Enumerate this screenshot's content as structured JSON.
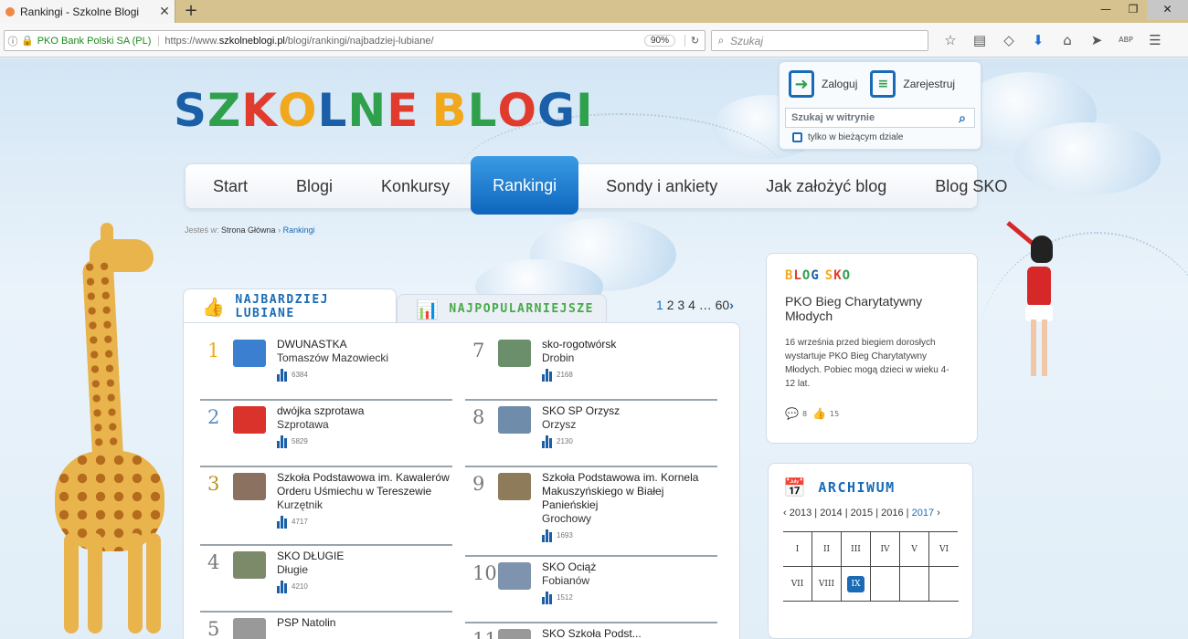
{
  "browser": {
    "tab_title": "Rankingi - Szkolne Blogi",
    "tab_close": "✕",
    "new_tab": "+",
    "url_info": "ⓘ",
    "url_lock": "🔒",
    "cert_label": "PKO Bank Polski SA (PL)",
    "url_prefix": "https://www.",
    "url_domain": "szkolneblogi.pl",
    "url_path": "/blogi/rankingi/najbadziej-lubiane/",
    "zoom": "90%",
    "reload": "↻",
    "search_placeholder": "Szukaj",
    "search_icon": "⌕",
    "win_min": "—",
    "win_max": "❐",
    "win_close": "✕",
    "toolbar": {
      "bookmark_star": "☆",
      "reader_list": "▤",
      "pocket": "◇",
      "download": "⬇",
      "home": "⌂",
      "send": "➤",
      "adblock": "ABP",
      "menu": "☰"
    }
  },
  "header": {
    "logo_letters": [
      {
        "ch": "S",
        "color": "#1a5fa8"
      },
      {
        "ch": "Z",
        "color": "#2fa04b"
      },
      {
        "ch": "K",
        "color": "#e13b2e"
      },
      {
        "ch": "O",
        "color": "#f2a81d"
      },
      {
        "ch": "L",
        "color": "#1a5fa8"
      },
      {
        "ch": "N",
        "color": "#2fa04b"
      },
      {
        "ch": "E",
        "color": "#e13b2e"
      },
      {
        "ch": " ",
        "color": "#000"
      },
      {
        "ch": "B",
        "color": "#f2a81d"
      },
      {
        "ch": "L",
        "color": "#2fa04b"
      },
      {
        "ch": "O",
        "color": "#e13b2e"
      },
      {
        "ch": "G",
        "color": "#1a5fa8"
      },
      {
        "ch": "I",
        "color": "#2fa04b"
      }
    ],
    "login_label": "Zaloguj",
    "login_icon": "➜",
    "register_label": "Zarejestruj",
    "register_icon": "≡",
    "site_search_placeholder": "Szukaj w witrynie",
    "site_search_icon": "⌕",
    "only_section_label": "tylko w bieżącym dziale"
  },
  "menu": [
    {
      "label": "Start",
      "active": false
    },
    {
      "label": "Blogi",
      "active": false
    },
    {
      "label": "Konkursy",
      "active": false
    },
    {
      "label": "Rankingi",
      "active": true
    },
    {
      "label": "Sondy i ankiety",
      "active": false
    },
    {
      "label": "Jak założyć blog",
      "active": false
    },
    {
      "label": "Blog SKO",
      "active": false
    }
  ],
  "breadcrumb": {
    "prefix": "Jesteś w:",
    "home": "Strona Główna",
    "separator": "›",
    "current": "Rankingi"
  },
  "ranking": {
    "tab_loved": "NAJBARDZIEJ LUBIANE",
    "tab_loved_icon": "👍",
    "tab_popular": "NAJPOPULARNIEJSZE",
    "tab_popular_icon": "📊",
    "pager": {
      "current": "1",
      "pages": [
        "2",
        "3",
        "4"
      ],
      "ellipsis": "…",
      "last": "60",
      "next": "›"
    },
    "left": [
      {
        "num": "1",
        "num_color": "#f2a81d",
        "name": "DWUNASTKA",
        "place": "Tomaszów Mazowiecki",
        "count": "6384",
        "thumb": "#3a7fd0"
      },
      {
        "num": "2",
        "num_color": "#5a8fc0",
        "name": "dwójka szprotawa",
        "place": "Szprotawa",
        "count": "5829",
        "thumb": "#d9332b"
      },
      {
        "num": "3",
        "num_color": "#b89324",
        "name": "Szkoła Podstawowa im. Kawalerów Orderu Uśmiechu w Tereszewie",
        "place": "Kurzętnik",
        "count": "4717",
        "thumb": "#8a7160"
      },
      {
        "num": "4",
        "num_color": "#777",
        "name": "SKO DŁUGIE",
        "place": "Długie",
        "count": "4210",
        "thumb": "#7d8a6a"
      },
      {
        "num": "5",
        "num_color": "#777",
        "name": "PSP Natolin",
        "place": "",
        "count": "",
        "thumb": "#999"
      }
    ],
    "right": [
      {
        "num": "7",
        "num_color": "#777",
        "name": "sko-rogotwórsk",
        "place": "Drobin",
        "count": "2168",
        "thumb": "#6b8f6b"
      },
      {
        "num": "8",
        "num_color": "#777",
        "name": "SKO SP Orzysz",
        "place": "Orzysz",
        "count": "2130",
        "thumb": "#6f8cab"
      },
      {
        "num": "9",
        "num_color": "#777",
        "name": "Szkoła Podstawowa im. Kornela Makuszyńskiego w Białej Panieńskiej",
        "place": "Grochowy",
        "count": "1693",
        "thumb": "#8e7b5a"
      },
      {
        "num": "10",
        "num_color": "#777",
        "name": "SKO Ociąż",
        "place": "Fobianów",
        "count": "1512",
        "thumb": "#7e93ad"
      },
      {
        "num": "11",
        "num_color": "#777",
        "name": "SKO Szkoła Podst...",
        "place": "",
        "count": "",
        "thumb": "#999"
      }
    ]
  },
  "blog_sko": {
    "heading_letters": [
      {
        "ch": "B",
        "color": "#f2a81d"
      },
      {
        "ch": "L",
        "color": "#e13b2e"
      },
      {
        "ch": "O",
        "color": "#2fa04b"
      },
      {
        "ch": "G",
        "color": "#1a5fa8"
      },
      {
        "ch": " ",
        "color": "#000"
      },
      {
        "ch": "S",
        "color": "#f2a81d"
      },
      {
        "ch": "K",
        "color": "#e13b2e"
      },
      {
        "ch": "O",
        "color": "#2fa04b"
      }
    ],
    "title": "PKO Bieg Charytatywny Młodych",
    "desc": "16 września przed biegiem dorosłych wystartuje PKO Bieg Charytatywny Młodych. Pobiec mogą dzieci w wieku 4-12 lat.",
    "comment_icon": "💬",
    "comments": "8",
    "like_icon": "👍",
    "likes": "15"
  },
  "archive": {
    "icon": "📅",
    "title": "ARCHIWUM",
    "prev": "‹",
    "next": "›",
    "years": [
      "2013",
      "2014",
      "2015",
      "2016",
      "2017"
    ],
    "selected_year": "2017",
    "months": [
      "I",
      "II",
      "III",
      "IV",
      "V",
      "VI",
      "VII",
      "VIII",
      "IX",
      "",
      "",
      ""
    ],
    "selected_month": "IX"
  }
}
